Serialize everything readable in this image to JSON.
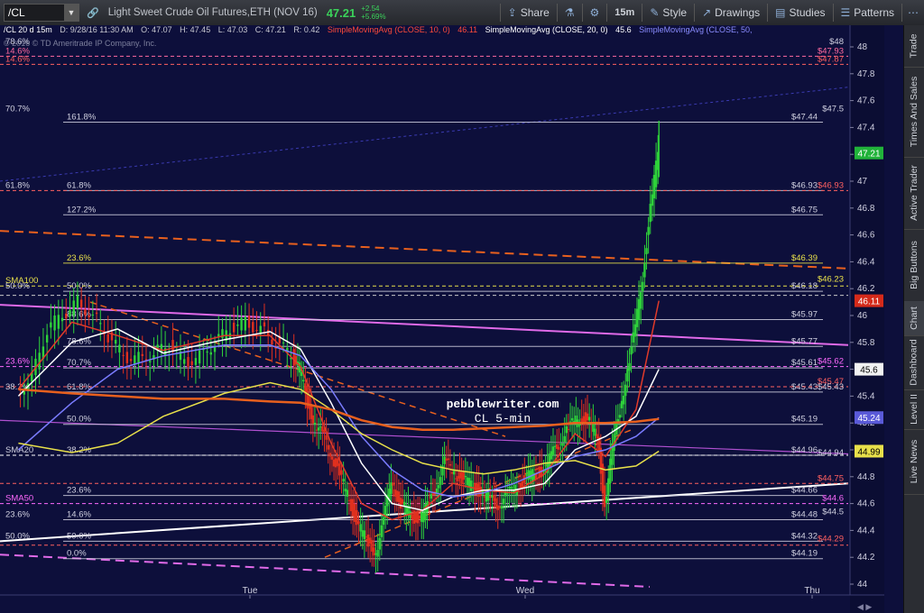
{
  "toolbar": {
    "symbol": "/CL",
    "description": "Light Sweet Crude Oil Futures,ETH (NOV 16)",
    "last": "47.21",
    "change": "+2.54",
    "change_pct": "+5.69%",
    "share": "Share",
    "interval": "15m",
    "style": "Style",
    "drawings": "Drawings",
    "studies": "Studies",
    "patterns": "Patterns"
  },
  "info": {
    "symbol": "/CL 20 d 15m",
    "date": "D: 9/28/16 11:30 AM",
    "open": "O: 47.07",
    "high": "H: 47.45",
    "low": "L: 47.03",
    "close": "C: 47.21",
    "range": "R: 0.42",
    "sma10": "SimpleMovingAvg (CLOSE, 10, 0)",
    "sma10_val": "46.11",
    "sma20": "SimpleMovingAvg (CLOSE, 20, 0)",
    "sma20_val": "45.6",
    "sma50": "SimpleMovingAvg (CLOSE, 50,",
    "copyright": "© 2016 © TD Ameritrade IP Company, Inc."
  },
  "side_tabs": [
    "Trade",
    "Times And Sales",
    "Active Trader",
    "Big Buttons",
    "Chart",
    "Dashboard",
    "Level II",
    "Live News"
  ],
  "watermark": [
    "pebblewriter.com",
    "CL 5-min"
  ],
  "colors": {
    "background": "#0d0f3b",
    "candle_up": "#2ed13a",
    "candle_down": "#e0301e",
    "sma10": "#e03a2a",
    "sma20": "#ffffff",
    "sma50": "#7a7cff",
    "sma100": "#e8e04a",
    "sma200": "#e8601e"
  },
  "chart_data": {
    "type": "line",
    "title": "/CL 20 d 15m",
    "x_ticks": [
      "Tue",
      "Wed",
      "Thu"
    ],
    "y_ticks": [
      44,
      44.2,
      44.4,
      44.6,
      44.8,
      45,
      45.2,
      45.4,
      45.6,
      45.8,
      46,
      46.2,
      46.4,
      46.6,
      46.8,
      47,
      47.2,
      47.4,
      47.6,
      47.8,
      48
    ],
    "ylim": [
      44,
      48.1
    ],
    "xlim": [
      0,
      96
    ],
    "price_path": [
      [
        1,
        45.42
      ],
      [
        3,
        45.55
      ],
      [
        5,
        45.9
      ],
      [
        7,
        46.0
      ],
      [
        9,
        46.1
      ],
      [
        11,
        46.0
      ],
      [
        13,
        45.85
      ],
      [
        15,
        45.7
      ],
      [
        17,
        45.68
      ],
      [
        19,
        45.72
      ],
      [
        21,
        45.78
      ],
      [
        23,
        45.65
      ],
      [
        25,
        45.7
      ],
      [
        27,
        45.8
      ],
      [
        29,
        45.9
      ],
      [
        31,
        45.95
      ],
      [
        33,
        45.9
      ],
      [
        35,
        45.8
      ],
      [
        37,
        45.7
      ],
      [
        38,
        45.6
      ],
      [
        39,
        45.35
      ],
      [
        40,
        45.2
      ],
      [
        41,
        45.1
      ],
      [
        42,
        45.0
      ],
      [
        43,
        44.85
      ],
      [
        44,
        44.7
      ],
      [
        45,
        44.55
      ],
      [
        46,
        44.4
      ],
      [
        47,
        44.3
      ],
      [
        48,
        44.25
      ],
      [
        49,
        44.45
      ],
      [
        50,
        44.8
      ],
      [
        51,
        44.6
      ],
      [
        52,
        44.55
      ],
      [
        53,
        44.5
      ],
      [
        54,
        44.5
      ],
      [
        55,
        44.6
      ],
      [
        56,
        44.75
      ],
      [
        57,
        44.9
      ],
      [
        58,
        44.85
      ],
      [
        59,
        44.8
      ],
      [
        60,
        44.75
      ],
      [
        61,
        44.72
      ],
      [
        62,
        44.68
      ],
      [
        63,
        44.62
      ],
      [
        64,
        44.6
      ],
      [
        65,
        44.65
      ],
      [
        66,
        44.7
      ],
      [
        67,
        44.75
      ],
      [
        68,
        44.8
      ],
      [
        69,
        44.82
      ],
      [
        70,
        44.85
      ],
      [
        71,
        44.95
      ],
      [
        72,
        45.05
      ],
      [
        73,
        45.15
      ],
      [
        74,
        45.2
      ],
      [
        75,
        45.25
      ],
      [
        76,
        45.2
      ],
      [
        77,
        45.1
      ],
      [
        78,
        44.6
      ],
      [
        79,
        45.0
      ],
      [
        80,
        45.3
      ],
      [
        81,
        45.6
      ],
      [
        82,
        45.9
      ],
      [
        83,
        46.3
      ],
      [
        84,
        46.8
      ],
      [
        85,
        47.21
      ]
    ],
    "series": [
      {
        "name": "SMA10",
        "color": "#e03a2a",
        "points": [
          [
            1,
            45.45
          ],
          [
            8,
            45.95
          ],
          [
            14,
            45.85
          ],
          [
            20,
            45.74
          ],
          [
            28,
            45.85
          ],
          [
            34,
            45.85
          ],
          [
            38,
            45.62
          ],
          [
            42,
            45.05
          ],
          [
            46,
            44.6
          ],
          [
            50,
            44.48
          ],
          [
            54,
            44.55
          ],
          [
            58,
            44.75
          ],
          [
            62,
            44.7
          ],
          [
            66,
            44.68
          ],
          [
            70,
            44.82
          ],
          [
            74,
            45.12
          ],
          [
            78,
            44.95
          ],
          [
            82,
            45.3
          ],
          [
            85,
            46.11
          ]
        ]
      },
      {
        "name": "SMA20",
        "color": "#ffffff",
        "points": [
          [
            1,
            45.4
          ],
          [
            8,
            45.8
          ],
          [
            14,
            45.9
          ],
          [
            20,
            45.72
          ],
          [
            28,
            45.82
          ],
          [
            34,
            45.88
          ],
          [
            38,
            45.75
          ],
          [
            42,
            45.35
          ],
          [
            46,
            44.9
          ],
          [
            50,
            44.6
          ],
          [
            54,
            44.55
          ],
          [
            58,
            44.65
          ],
          [
            62,
            44.7
          ],
          [
            66,
            44.7
          ],
          [
            70,
            44.75
          ],
          [
            74,
            45.0
          ],
          [
            78,
            45.1
          ],
          [
            82,
            45.25
          ],
          [
            85,
            45.6
          ]
        ]
      },
      {
        "name": "SMA50",
        "color": "#7a7cff",
        "points": [
          [
            1,
            45.0
          ],
          [
            8,
            45.35
          ],
          [
            14,
            45.6
          ],
          [
            20,
            45.7
          ],
          [
            28,
            45.78
          ],
          [
            34,
            45.78
          ],
          [
            38,
            45.7
          ],
          [
            42,
            45.45
          ],
          [
            46,
            45.1
          ],
          [
            50,
            44.85
          ],
          [
            54,
            44.7
          ],
          [
            58,
            44.65
          ],
          [
            62,
            44.68
          ],
          [
            66,
            44.75
          ],
          [
            70,
            44.85
          ],
          [
            74,
            44.95
          ],
          [
            78,
            45.0
          ],
          [
            82,
            45.1
          ],
          [
            85,
            45.24
          ]
        ]
      },
      {
        "name": "SMA100",
        "color": "#e8e04a",
        "points": [
          [
            1,
            45.05
          ],
          [
            8,
            44.98
          ],
          [
            14,
            45.05
          ],
          [
            20,
            45.25
          ],
          [
            28,
            45.42
          ],
          [
            34,
            45.5
          ],
          [
            38,
            45.45
          ],
          [
            42,
            45.3
          ],
          [
            46,
            45.12
          ],
          [
            50,
            45.0
          ],
          [
            54,
            44.9
          ],
          [
            58,
            44.85
          ],
          [
            62,
            44.82
          ],
          [
            66,
            44.85
          ],
          [
            70,
            44.9
          ],
          [
            74,
            44.92
          ],
          [
            78,
            44.85
          ],
          [
            82,
            44.88
          ],
          [
            85,
            44.99
          ]
        ]
      },
      {
        "name": "SMA200",
        "color": "#e8601e",
        "points": [
          [
            1,
            45.45
          ],
          [
            8,
            45.42
          ],
          [
            14,
            45.4
          ],
          [
            20,
            45.38
          ],
          [
            28,
            45.38
          ],
          [
            34,
            45.36
          ],
          [
            38,
            45.35
          ],
          [
            42,
            45.3
          ],
          [
            46,
            45.22
          ],
          [
            50,
            45.17
          ],
          [
            54,
            45.15
          ],
          [
            58,
            45.15
          ],
          [
            62,
            45.16
          ],
          [
            66,
            45.17
          ],
          [
            70,
            45.18
          ],
          [
            74,
            45.2
          ],
          [
            78,
            45.2
          ],
          [
            82,
            45.21
          ],
          [
            85,
            45.23
          ]
        ]
      }
    ],
    "price_labels": [
      {
        "value": 47.21,
        "text": "47.21",
        "bg": "#21b33a",
        "fg": "#ffffff"
      },
      {
        "value": 46.11,
        "text": "46.11",
        "bg": "#d52a1a",
        "fg": "#ffffff"
      },
      {
        "value": 45.6,
        "text": "45.6",
        "bg": "#f2f2f2",
        "fg": "#000000"
      },
      {
        "value": 45.24,
        "text": "45.24",
        "bg": "#5a5ad8",
        "fg": "#ffffff"
      },
      {
        "value": 44.99,
        "text": "44.99",
        "bg": "#e8e04a",
        "fg": "#000000"
      }
    ],
    "levels": [
      {
        "value": 47.44,
        "label": "161.8%",
        "price": "$47.44",
        "color": "#d0d0e0"
      },
      {
        "value": 46.93,
        "label": "61.8%",
        "price": "$46.93",
        "color": "#d0d0e0"
      },
      {
        "value": 46.75,
        "label": "127.2%",
        "price": "$46.75",
        "color": "#d0d0e0"
      },
      {
        "value": 46.39,
        "label": "23.6%",
        "price": "$46.39",
        "color": "#e8e04a"
      },
      {
        "value": 46.18,
        "label": "50.0%",
        "price": "$46.18",
        "color": "#d0d0e0"
      },
      {
        "value": 45.97,
        "label": "88.6%",
        "price": "$45.97",
        "color": "#d0d0e0"
      },
      {
        "value": 45.77,
        "label": "78.6%",
        "price": "$45.77",
        "color": "#d0d0e0"
      },
      {
        "value": 45.61,
        "label": "70.7%",
        "price": "$45.61",
        "color": "#d0d0e0"
      },
      {
        "value": 45.43,
        "label": "61.8%",
        "price": "$45.43",
        "color": "#d0d0e0"
      },
      {
        "value": 45.19,
        "label": "50.0%",
        "price": "$45.19",
        "color": "#d0d0e0"
      },
      {
        "value": 44.96,
        "label": "38.2%",
        "price": "$44.96",
        "color": "#d0d0e0"
      },
      {
        "value": 44.66,
        "label": "23.6%",
        "price": "$44.66",
        "color": "#d0d0e0"
      },
      {
        "value": 44.48,
        "label": "14.6%",
        "price": "$44.48",
        "color": "#d0d0e0"
      },
      {
        "value": 44.32,
        "label": "50.0%",
        "price": "$44.32",
        "color": "#d0d0e0"
      },
      {
        "value": 44.19,
        "label": "0.0%",
        "price": "$44.19",
        "color": "#d0d0e0"
      }
    ],
    "side_labels": [
      {
        "value": 48.0,
        "text": "$48",
        "color": "#d0d0e0"
      },
      {
        "value": 47.93,
        "text": "$47.93",
        "color": "#ff6aa0"
      },
      {
        "value": 47.87,
        "text": "$47.87",
        "color": "#ff6060"
      },
      {
        "value": 47.5,
        "text": "$47.5",
        "color": "#d0d0e0"
      },
      {
        "value": 46.93,
        "text": "$46.93",
        "color": "#ff6060"
      },
      {
        "value": 46.23,
        "text": "$46.23",
        "color": "#e8e04a"
      },
      {
        "value": 45.62,
        "text": "$45.62",
        "color": "#ff6aff"
      },
      {
        "value": 45.47,
        "text": "$45.47",
        "color": "#ff6060"
      },
      {
        "value": 45.43,
        "text": "$45.43",
        "color": "#d0d0e0"
      },
      {
        "value": 44.94,
        "text": "$44.94",
        "color": "#d0d0e0"
      },
      {
        "value": 44.75,
        "text": "$44.75",
        "color": "#ff6060"
      },
      {
        "value": 44.6,
        "text": "$44.6",
        "color": "#ff6aff"
      },
      {
        "value": 44.5,
        "text": "$44.5",
        "color": "#d0d0e0"
      },
      {
        "value": 44.3,
        "text": "$44.29",
        "color": "#ff6060"
      }
    ],
    "left_labels": [
      {
        "value": 48.0,
        "text": "78.6%",
        "color": "#d0d0e0"
      },
      {
        "value": 47.93,
        "text": "14.6%",
        "color": "#ff6aa0"
      },
      {
        "value": 47.87,
        "text": "14.6%",
        "color": "#ff6060"
      },
      {
        "value": 47.5,
        "text": "70.7%",
        "color": "#d0d0e0"
      },
      {
        "value": 46.93,
        "text": "61.8%",
        "color": "#d0d0e0"
      },
      {
        "value": 46.18,
        "text": "50.0%",
        "color": "#d0d0e0"
      },
      {
        "value": 46.22,
        "text": "SMA100",
        "color": "#e8e04a"
      },
      {
        "value": 45.62,
        "text": "23.6%",
        "color": "#ff6aff"
      },
      {
        "value": 45.43,
        "text": "38.2%",
        "color": "#d0d0e0"
      },
      {
        "value": 44.96,
        "text": "SMA20",
        "color": "#d0d0e0"
      },
      {
        "value": 44.6,
        "text": "SMA50",
        "color": "#ff6aff"
      },
      {
        "value": 44.48,
        "text": "23.6%",
        "color": "#d0d0e0"
      },
      {
        "value": 44.32,
        "text": "50.0%",
        "color": "#d0d0e0"
      }
    ]
  }
}
